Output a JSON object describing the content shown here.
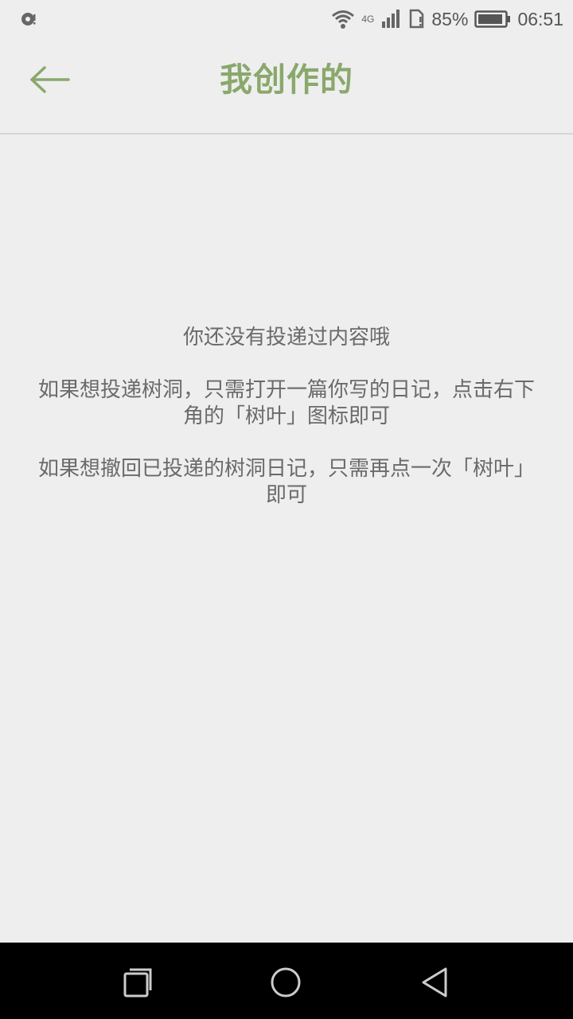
{
  "status_bar": {
    "network_type": "4G",
    "battery": "85%",
    "time": "06:51"
  },
  "header": {
    "title": "我创作的"
  },
  "empty_state": {
    "line1": "你还没有投递过内容哦",
    "line2": "如果想投递树洞，只需打开一篇你写的日记，点击右下角的「树叶」图标即可",
    "line3": "如果想撤回已投递的树洞日记，只需再点一次「树叶」即可"
  },
  "colors": {
    "accent": "#8aa86c",
    "background": "#eeeeee",
    "nav_bar": "#000000"
  },
  "icons": {
    "back": "arrow-left-icon",
    "recents": "recents-square-icon",
    "home": "home-circle-icon",
    "nav_back": "triangle-back-icon"
  }
}
